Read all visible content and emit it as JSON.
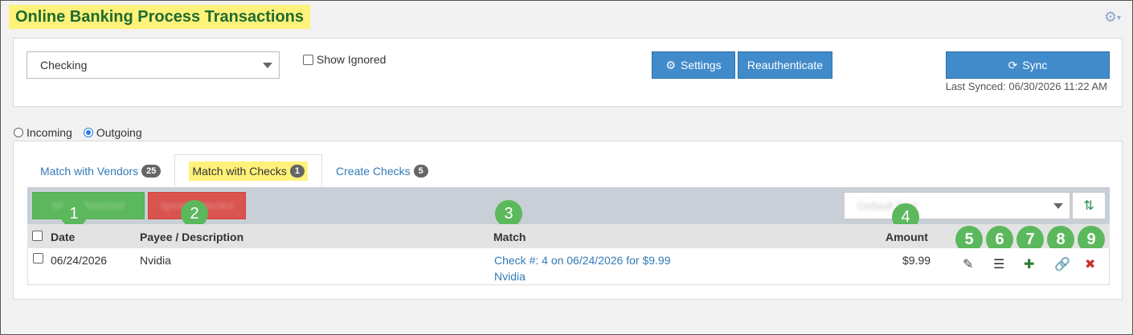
{
  "page": {
    "title": "Online Banking Process Transactions"
  },
  "account": {
    "selected": "Checking"
  },
  "show_ignored_label": "Show Ignored",
  "buttons": {
    "settings": "Settings",
    "reauthenticate": "Reauthenticate",
    "sync": "Sync"
  },
  "last_synced": "Last Synced: 06/30/2026 11:22 AM",
  "direction": {
    "incoming": "Incoming",
    "outgoing": "Outgoing",
    "selected": "Outgoing"
  },
  "tabs": [
    {
      "label": "Match with Vendors",
      "count": "25"
    },
    {
      "label": "Match with Checks",
      "count": "1"
    },
    {
      "label": "Create Checks",
      "count": "5"
    }
  ],
  "toolbar": {
    "match_selected": "Match Selected",
    "ignore_selected": "Ignore Selected",
    "sort_value": "Default Sort"
  },
  "table": {
    "headers": {
      "date": "Date",
      "payee": "Payee / Description",
      "match": "Match",
      "amount": "Amount"
    },
    "rows": [
      {
        "date": "06/24/2026",
        "payee": "Nvidia",
        "match_line1": "Check #: 4 on 06/24/2026 for $9.99",
        "match_line2": "Nvidia",
        "amount": "$9.99"
      }
    ]
  },
  "callouts": [
    "1",
    "2",
    "3",
    "4",
    "5",
    "6",
    "7",
    "8",
    "9"
  ],
  "colors": {
    "accent": "#428bca",
    "callout": "#5cb85c",
    "highlight": "#fff27a",
    "title": "#1f6b31"
  },
  "icons": [
    "gear-icon",
    "refresh-icon",
    "sort-icon",
    "edit-icon",
    "list-icon",
    "plus-icon",
    "link-icon",
    "close-icon"
  ]
}
